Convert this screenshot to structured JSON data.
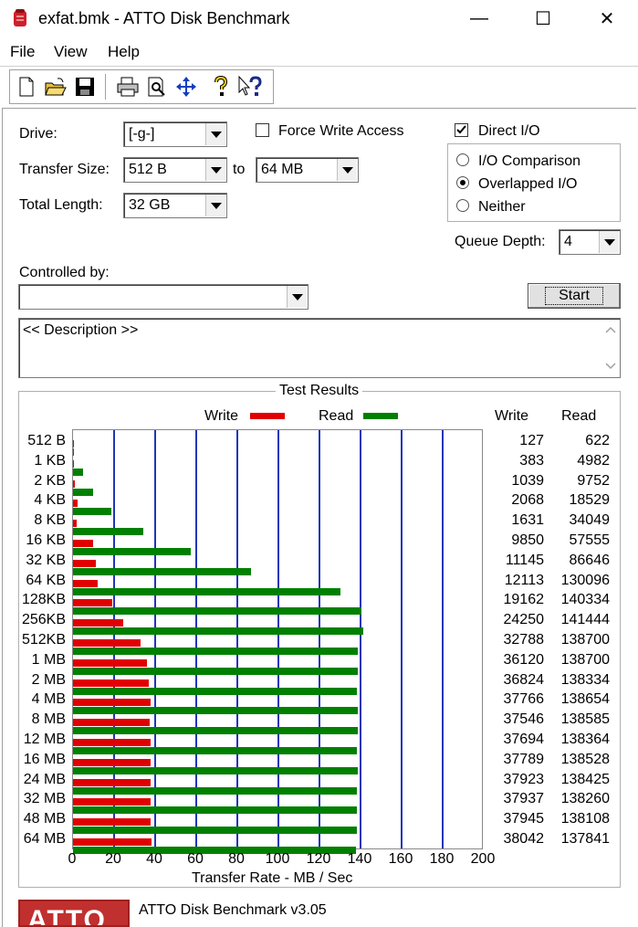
{
  "window": {
    "title": "exfat.bmk - ATTO Disk Benchmark",
    "minimize_glyph": "—",
    "maximize_glyph": "☐",
    "close_glyph": "✕"
  },
  "menu": {
    "file": "File",
    "view": "View",
    "help": "Help"
  },
  "toolbar": {
    "icons": [
      "new-file-icon",
      "open-folder-icon",
      "save-icon",
      "print-icon",
      "print-preview-icon",
      "move-icon",
      "help-icon",
      "context-help-icon"
    ]
  },
  "form": {
    "drive_label": "Drive:",
    "drive_value": "[-g-]",
    "transfer_size_label": "Transfer Size:",
    "transfer_from": "512 B",
    "to_label": "to",
    "transfer_to": "64 MB",
    "total_length_label": "Total Length:",
    "total_length_value": "32 GB",
    "force_write_label": "Force Write Access",
    "force_write_checked": false,
    "direct_io_label": "Direct I/O",
    "direct_io_checked": true,
    "io_comparison_label": "I/O Comparison",
    "overlapped_io_label": "Overlapped I/O",
    "neither_label": "Neither",
    "selected_mode": "overlapped",
    "queue_depth_label": "Queue Depth:",
    "queue_depth_value": "4",
    "controlled_by_label": "Controlled by:",
    "controlled_by_value": "",
    "start_label": "Start",
    "description": "<< Description >>"
  },
  "results": {
    "group_title": "Test Results",
    "legend_write": "Write",
    "legend_read": "Read",
    "col_write": "Write",
    "col_read": "Read",
    "footer_logo": "ATTO",
    "footer_version": "ATTO Disk Benchmark v3.05"
  },
  "chart_data": {
    "type": "bar",
    "orientation": "horizontal",
    "xlabel": "Transfer Rate - MB / Sec",
    "xlim": [
      0,
      200
    ],
    "xticks": [
      0,
      20,
      40,
      60,
      80,
      100,
      120,
      140,
      160,
      180,
      200
    ],
    "colors": {
      "write": "#e00000",
      "read": "#008000",
      "grid": "#1f35b8"
    },
    "categories": [
      "512 B",
      "1 KB",
      "2 KB",
      "4 KB",
      "8 KB",
      "16 KB",
      "32 KB",
      "64 KB",
      "128KB",
      "256KB",
      "512KB",
      "1 MB",
      "2 MB",
      "4 MB",
      "8 MB",
      "12 MB",
      "16 MB",
      "24 MB",
      "32 MB",
      "48 MB",
      "64 MB"
    ],
    "series": [
      {
        "name": "Write",
        "values": [
          127,
          383,
          1039,
          2068,
          1631,
          9850,
          11145,
          12113,
          19162,
          24250,
          32788,
          36120,
          36824,
          37766,
          37546,
          37694,
          37789,
          37923,
          37937,
          37945,
          38042
        ]
      },
      {
        "name": "Read",
        "values": [
          622,
          4982,
          9752,
          18529,
          34049,
          57555,
          86646,
          130096,
          140334,
          141444,
          138700,
          138700,
          138334,
          138654,
          138585,
          138364,
          138528,
          138425,
          138260,
          138108,
          137841
        ]
      }
    ]
  }
}
